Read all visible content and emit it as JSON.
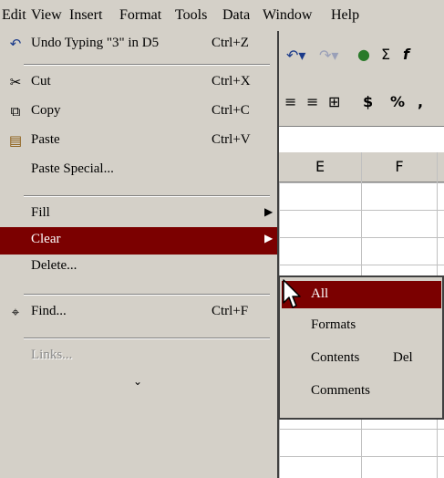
{
  "menubar": {
    "items": [
      "Edit",
      "View",
      "Insert",
      "Format",
      "Tools",
      "Data",
      "Window",
      "Help"
    ]
  },
  "edit_menu": {
    "items": [
      {
        "label": "Undo Typing \"3\" in D5",
        "shortcut": "Ctrl+Z",
        "icon": "undo-icon"
      },
      {
        "label": "Cut",
        "shortcut": "Ctrl+X",
        "icon": "scissors-icon"
      },
      {
        "label": "Copy",
        "shortcut": "Ctrl+C",
        "icon": "copy-icon"
      },
      {
        "label": "Paste",
        "shortcut": "Ctrl+V",
        "icon": "paste-icon"
      },
      {
        "label": "Paste Special...",
        "shortcut": ""
      },
      {
        "label": "Fill",
        "shortcut": "",
        "submenu": true
      },
      {
        "label": "Clear",
        "shortcut": "",
        "submenu": true,
        "highlighted": true
      },
      {
        "label": "Delete...",
        "shortcut": ""
      },
      {
        "label": "Find...",
        "shortcut": "Ctrl+F",
        "icon": "binoculars-icon"
      },
      {
        "label": "Links...",
        "shortcut": "",
        "disabled": true
      }
    ],
    "expand_icon": "double-chevron-down-icon"
  },
  "clear_submenu": {
    "items": [
      {
        "label": "All",
        "shortcut": "",
        "highlighted": true
      },
      {
        "label": "Formats",
        "shortcut": ""
      },
      {
        "label": "Contents",
        "shortcut": "Del"
      },
      {
        "label": "Comments",
        "shortcut": ""
      }
    ]
  },
  "spreadsheet": {
    "columns": [
      "E",
      "F"
    ],
    "toolbar_symbols": [
      "$",
      "%",
      ",",
      "Σ",
      "f"
    ]
  },
  "colors": {
    "menu_bg": "#d4d0c8",
    "highlight": "#7b0000",
    "highlight_text": "#ffffff",
    "disabled_text": "#8a8a8a"
  }
}
